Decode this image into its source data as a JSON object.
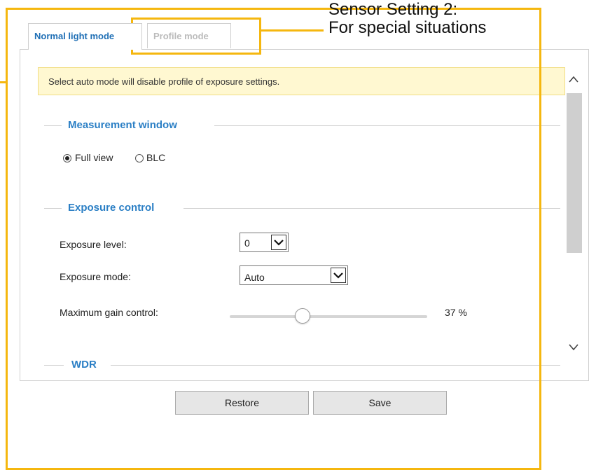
{
  "tabs": [
    {
      "label": "Normal light mode"
    },
    {
      "label": "Profile mode"
    }
  ],
  "annotation": {
    "line1": "Sensor Setting 2:",
    "line2": "For special situations"
  },
  "notice": "Select auto mode will disable profile of exposure settings.",
  "measurement": {
    "title": "Measurement window",
    "options": [
      {
        "label": "Full view",
        "selected": true
      },
      {
        "label": "BLC",
        "selected": false
      }
    ]
  },
  "exposure": {
    "title": "Exposure control",
    "level": {
      "label": "Exposure level:",
      "value": "0"
    },
    "mode": {
      "label": "Exposure mode:",
      "value": "Auto"
    },
    "gain": {
      "label": "Maximum gain control:",
      "value_text": "37 %",
      "value": 37
    }
  },
  "wdr": {
    "title": "WDR"
  },
  "buttons": {
    "restore": "Restore",
    "save": "Save"
  },
  "colors": {
    "accent": "#2b7fc5",
    "annotation": "#f5b70f",
    "notice_bg": "#fff8d1"
  },
  "icons": {
    "scroll_up": "chevron-up-icon",
    "scroll_down": "chevron-down-icon",
    "select_arrow": "chevron-down-icon"
  }
}
